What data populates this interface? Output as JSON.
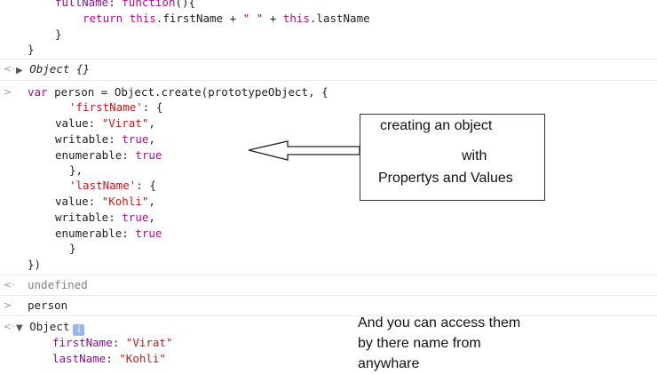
{
  "console": {
    "line1_prop": "fullName",
    "line1_colon": ": ",
    "line1_kw": "function",
    "line1_rest": "(){",
    "line2_kw_return": "return",
    "line2_this1": "this",
    "line2_mid": ".firstName + ",
    "line2_str": "\" \"",
    "line2_plus": " + ",
    "line2_this2": "this",
    "line2_end": ".lastName",
    "line3": "}",
    "line4": "}",
    "result1_arrow": "▶",
    "result1_text": "Object {}",
    "input_prompt": ">",
    "result_prompt": "<·",
    "cmd_kw_var": "var",
    "cmd_rest": " person = Object.create(prototypeObject, {",
    "fn_str": "'firstName'",
    "fn_open": ": {",
    "value_label": "value: ",
    "value_virat": "\"Virat\"",
    "comma": ",",
    "writable_label": "writable: ",
    "true_kw": "true",
    "enumerable_label": "enumerable: ",
    "close_brace_comma": "},",
    "ln_str": "'lastName'",
    "ln_open": ": {",
    "value_kohli": "\"Kohli\"",
    "close_brace": "}",
    "close_paren": "})",
    "undefined_text": "undefined",
    "person_cmd": "person",
    "result3_arrow": "▼",
    "result3_text": "Object",
    "info_badge": "i",
    "prop_first_name": "firstName",
    "prop_first_value": "\"Virat\"",
    "prop_last_name": "lastName",
    "prop_last_value": "\"Kohli\"",
    "prop_colon": ": "
  },
  "annotations": {
    "box_line1": "creating an object",
    "box_line2": "with",
    "box_line3": "Propertys and Values",
    "note_line1": "And you can access them",
    "note_line2": "by there name from",
    "note_line3": "anywhare"
  }
}
